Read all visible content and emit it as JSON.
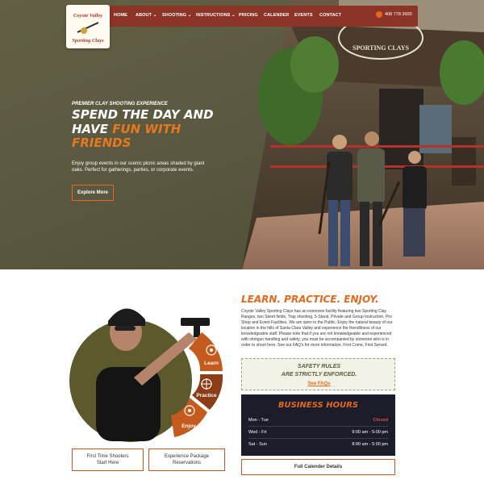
{
  "colors": {
    "accent": "#e3691d",
    "nav_bg": "#8b3427",
    "hero_bg": "#5c5a40",
    "hours_bg": "#1b1d2b",
    "wheel_orange": "#c45a1e",
    "wheel_brown": "#8a3d16"
  },
  "brand": {
    "logo_line1": "Coyote Valley",
    "logo_line2": "Sporting Clays"
  },
  "nav": {
    "items": [
      "HOME",
      "ABOUT",
      "SHOOTING",
      "INSTRUCTIONS",
      "PRICING",
      "CALENDER",
      "EVENTS",
      "CONTACT"
    ],
    "dropdown_flags": [
      false,
      true,
      true,
      true,
      false,
      false,
      false,
      false
    ],
    "phone": "408 778 3600"
  },
  "hero": {
    "sign_text": "SPORTING CLAYS",
    "kicker": "PREMIER CLAY SHOOTING EXPERIENCE",
    "title_line1": "SPEND THE DAY AND",
    "title_line2_plain": "HAVE ",
    "title_line2_accent": "FUN WITH",
    "title_line3_accent": "FRIENDS",
    "text": "Enjoy group events in our scenic picnic areas shaded by giant oaks. Perfect for gatherings, parties, or corporate events.",
    "button": "Explore More"
  },
  "wheel": {
    "labels": [
      "Learn",
      "Practice",
      "Enjoy"
    ],
    "icons": [
      "target-icon",
      "crosshair-icon",
      "target-icon"
    ]
  },
  "buttons": {
    "first_time": [
      "First Time Shooters",
      "Start Here"
    ],
    "packages": [
      "Experience Package",
      "Reservations"
    ]
  },
  "learn": {
    "title": "LEARN. PRACTICE. ENJOY.",
    "body": "Coyote Valley Sporting Clays has an extensive facility featuring two Sporting Clay Ranges, two Skeet fields, Trap shooting, 5-Stand, Private and Group Instruction, Pro Shop and Event Facilities. We are open to the Public. Enjoy the natural beauty of our location in the hills of Santa Clara Valley and experience the friendliness of our knowledgeable staff. Please note that if you are not knowledgeable and experienced with shotgun handling and safety, you must be accompanied by someone who is in order to shoot here. See our FAQ's for more information. First Come, First Served."
  },
  "safety": {
    "line1": "SAFETY RULES",
    "line2": "ARE STRICTLY ENFORCED.",
    "link": "See FAQs"
  },
  "hours": {
    "title": "BUSINESS HOURS",
    "rows": [
      {
        "day": "Mon - Tue",
        "time": "Closed"
      },
      {
        "day": "Wed - Fri",
        "time": "9:00 am - 5:00 pm"
      },
      {
        "day": "Sat - Sun",
        "time": "8:00 am - 5:00 pm"
      }
    ]
  },
  "calendar_button": "Full Calender Details"
}
